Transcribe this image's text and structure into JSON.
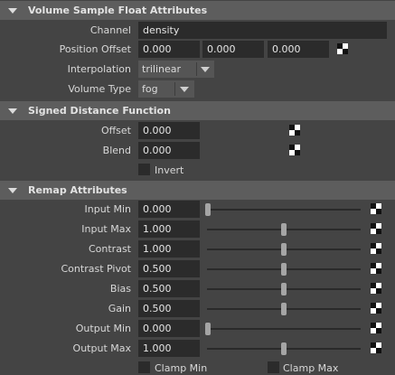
{
  "sections": {
    "volume": {
      "title": "Volume Sample Float Attributes",
      "channel": {
        "label": "Channel",
        "value": "density"
      },
      "position_offset": {
        "label": "Position Offset",
        "x": "0.000",
        "y": "0.000",
        "z": "0.000"
      },
      "interpolation": {
        "label": "Interpolation",
        "value": "trilinear"
      },
      "volume_type": {
        "label": "Volume Type",
        "value": "fog"
      }
    },
    "sdf": {
      "title": "Signed Distance Function",
      "offset": {
        "label": "Offset",
        "value": "0.000"
      },
      "blend": {
        "label": "Blend",
        "value": "0.000"
      },
      "invert": {
        "label": "Invert",
        "checked": false
      }
    },
    "remap": {
      "title": "Remap Attributes",
      "rows": [
        {
          "label": "Input Min",
          "value": "0.000",
          "slider_fraction": 0.0
        },
        {
          "label": "Input Max",
          "value": "1.000",
          "slider_fraction": 0.5
        },
        {
          "label": "Contrast",
          "value": "1.000",
          "slider_fraction": 0.5
        },
        {
          "label": "Contrast Pivot",
          "value": "0.500",
          "slider_fraction": 0.5
        },
        {
          "label": "Bias",
          "value": "0.500",
          "slider_fraction": 0.5
        },
        {
          "label": "Gain",
          "value": "0.500",
          "slider_fraction": 0.5
        },
        {
          "label": "Output Min",
          "value": "0.000",
          "slider_fraction": 0.0
        },
        {
          "label": "Output Max",
          "value": "1.000",
          "slider_fraction": 0.5
        }
      ],
      "clamp_min": {
        "label": "Clamp Min",
        "checked": false
      },
      "clamp_max": {
        "label": "Clamp Max",
        "checked": false
      }
    }
  },
  "icons": {
    "map_button": "checker-map-icon",
    "section_arrow": "triangle-down-icon",
    "dropdown": "dropdown-arrow-icon"
  },
  "colors": {
    "panel_bg": "#444444",
    "header_bg": "#5d5d5d",
    "field_bg": "#2b2b2b"
  }
}
